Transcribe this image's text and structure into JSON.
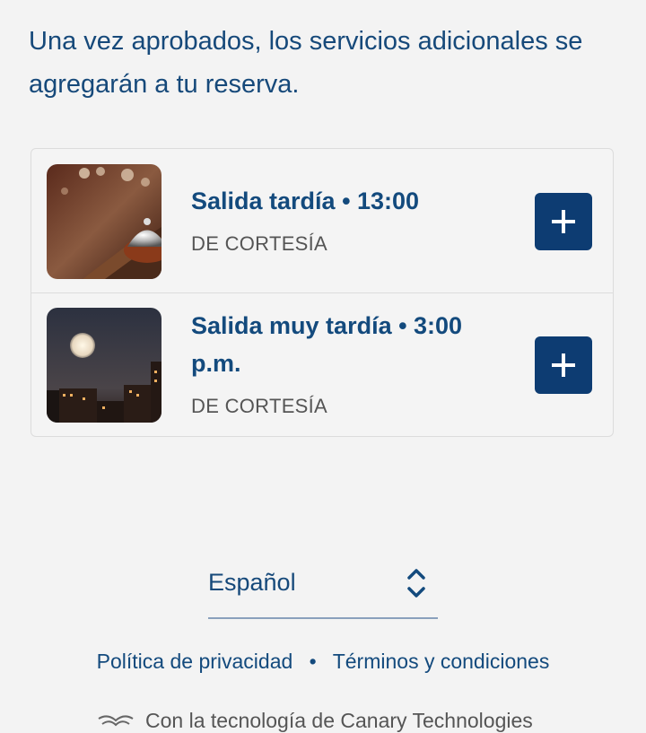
{
  "intro_text": "Una vez aprobados, los servicios adicionales se agregarán a tu reserva.",
  "services": [
    {
      "title": "Salida tardía • 13:00",
      "subtitle": "DE CORTESÍA",
      "image": "bell-image"
    },
    {
      "title": "Salida muy tardía • 3:00 p.m.",
      "subtitle": "DE CORTESÍA",
      "image": "moon-image"
    }
  ],
  "language": {
    "selected": "Español"
  },
  "footer": {
    "privacy": "Política de privacidad",
    "separator": "•",
    "terms": "Términos y condiciones",
    "powered_by": "Con la tecnología de Canary Technologies"
  },
  "colors": {
    "primary": "#0d3c72",
    "text": "#134a7d",
    "background": "#f3f3f3"
  }
}
